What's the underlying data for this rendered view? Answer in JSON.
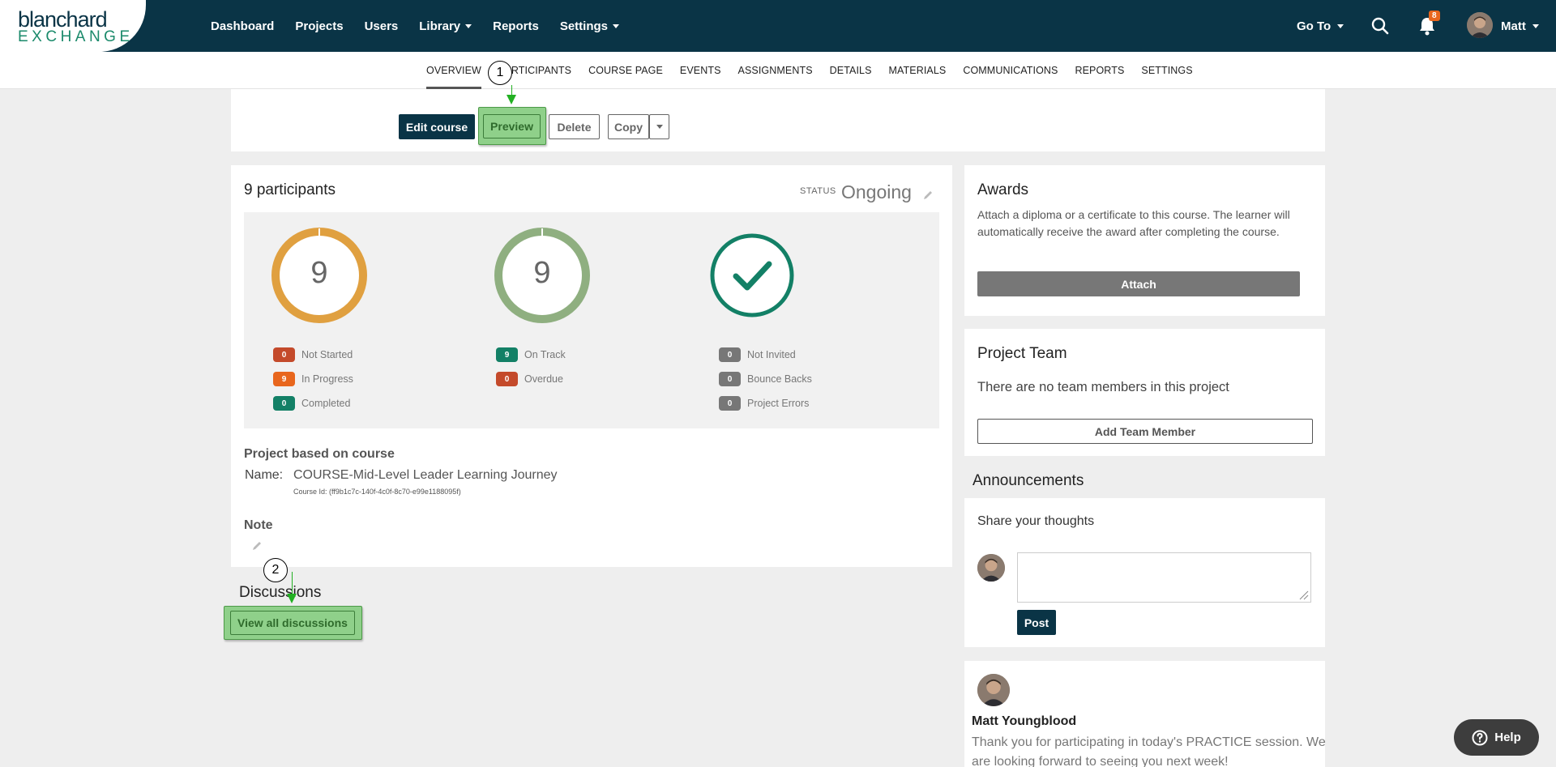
{
  "header": {
    "logo_top": "blanchard",
    "logo_bottom": "EXCHANGE",
    "nav": [
      "Dashboard",
      "Projects",
      "Users",
      "Library",
      "Reports",
      "Settings"
    ],
    "goto_label": "Go To",
    "notification_count": "8",
    "user_name": "Matt"
  },
  "subnav": {
    "tabs": [
      "OVERVIEW",
      "PARTICIPANTS",
      "COURSE PAGE",
      "EVENTS",
      "ASSIGNMENTS",
      "DETAILS",
      "MATERIALS",
      "COMMUNICATIONS",
      "REPORTS",
      "SETTINGS"
    ],
    "active_tab": "OVERVIEW"
  },
  "actions": {
    "edit": "Edit course",
    "preview": "Preview",
    "delete": "Delete",
    "copy": "Copy"
  },
  "participants": {
    "title": "9 participants",
    "status_label": "STATUS",
    "status_value": "Ongoing",
    "ring1_value": "9",
    "ring2_value": "9",
    "col1": [
      {
        "count": "0",
        "label": "Not Started",
        "color": "#c44a2b"
      },
      {
        "count": "9",
        "label": "In Progress",
        "color": "#e8661d"
      },
      {
        "count": "0",
        "label": "Completed",
        "color": "#138066"
      }
    ],
    "col2": [
      {
        "count": "9",
        "label": "On Track",
        "color": "#138066"
      },
      {
        "count": "0",
        "label": "Overdue",
        "color": "#c44a2b"
      }
    ],
    "col3": [
      {
        "count": "0",
        "label": "Not Invited",
        "color": "#777777"
      },
      {
        "count": "0",
        "label": "Bounce Backs",
        "color": "#777777"
      },
      {
        "count": "0",
        "label": "Project Errors",
        "color": "#777777"
      }
    ]
  },
  "course": {
    "based_title": "Project based on course",
    "name_label": "Name:",
    "name_value": "COURSE-Mid-Level Leader Learning Journey",
    "course_id": "Course Id: (ff9b1c7c-140f-4c0f-8c70-e99e1188095f)",
    "note_title": "Note"
  },
  "discussions": {
    "title": "Discussions",
    "button": "View all discussions"
  },
  "callouts": [
    "1",
    "2"
  ],
  "awards": {
    "title": "Awards",
    "text": "Attach a diploma or a certificate to this course. The learner will automatically receive the award after completing the course.",
    "button": "Attach"
  },
  "team": {
    "title": "Project Team",
    "empty": "There are no team members in this project",
    "button": "Add Team Member"
  },
  "announcements": {
    "title": "Announcements",
    "share_label": "Share your thoughts",
    "post_button": "Post",
    "post_author": "Matt Youngblood",
    "post_text": "Thank you for participating in today's PRACTICE session. We are looking forward to seeing you next week!"
  },
  "help": {
    "label": "Help"
  },
  "colors": {
    "brand_navy": "#0a3446",
    "brand_green": "#1b8a6b",
    "ring_orange": "#e0a040",
    "ring_green": "#8faf80",
    "check_green": "#138066",
    "highlight": "#8fd08a"
  }
}
